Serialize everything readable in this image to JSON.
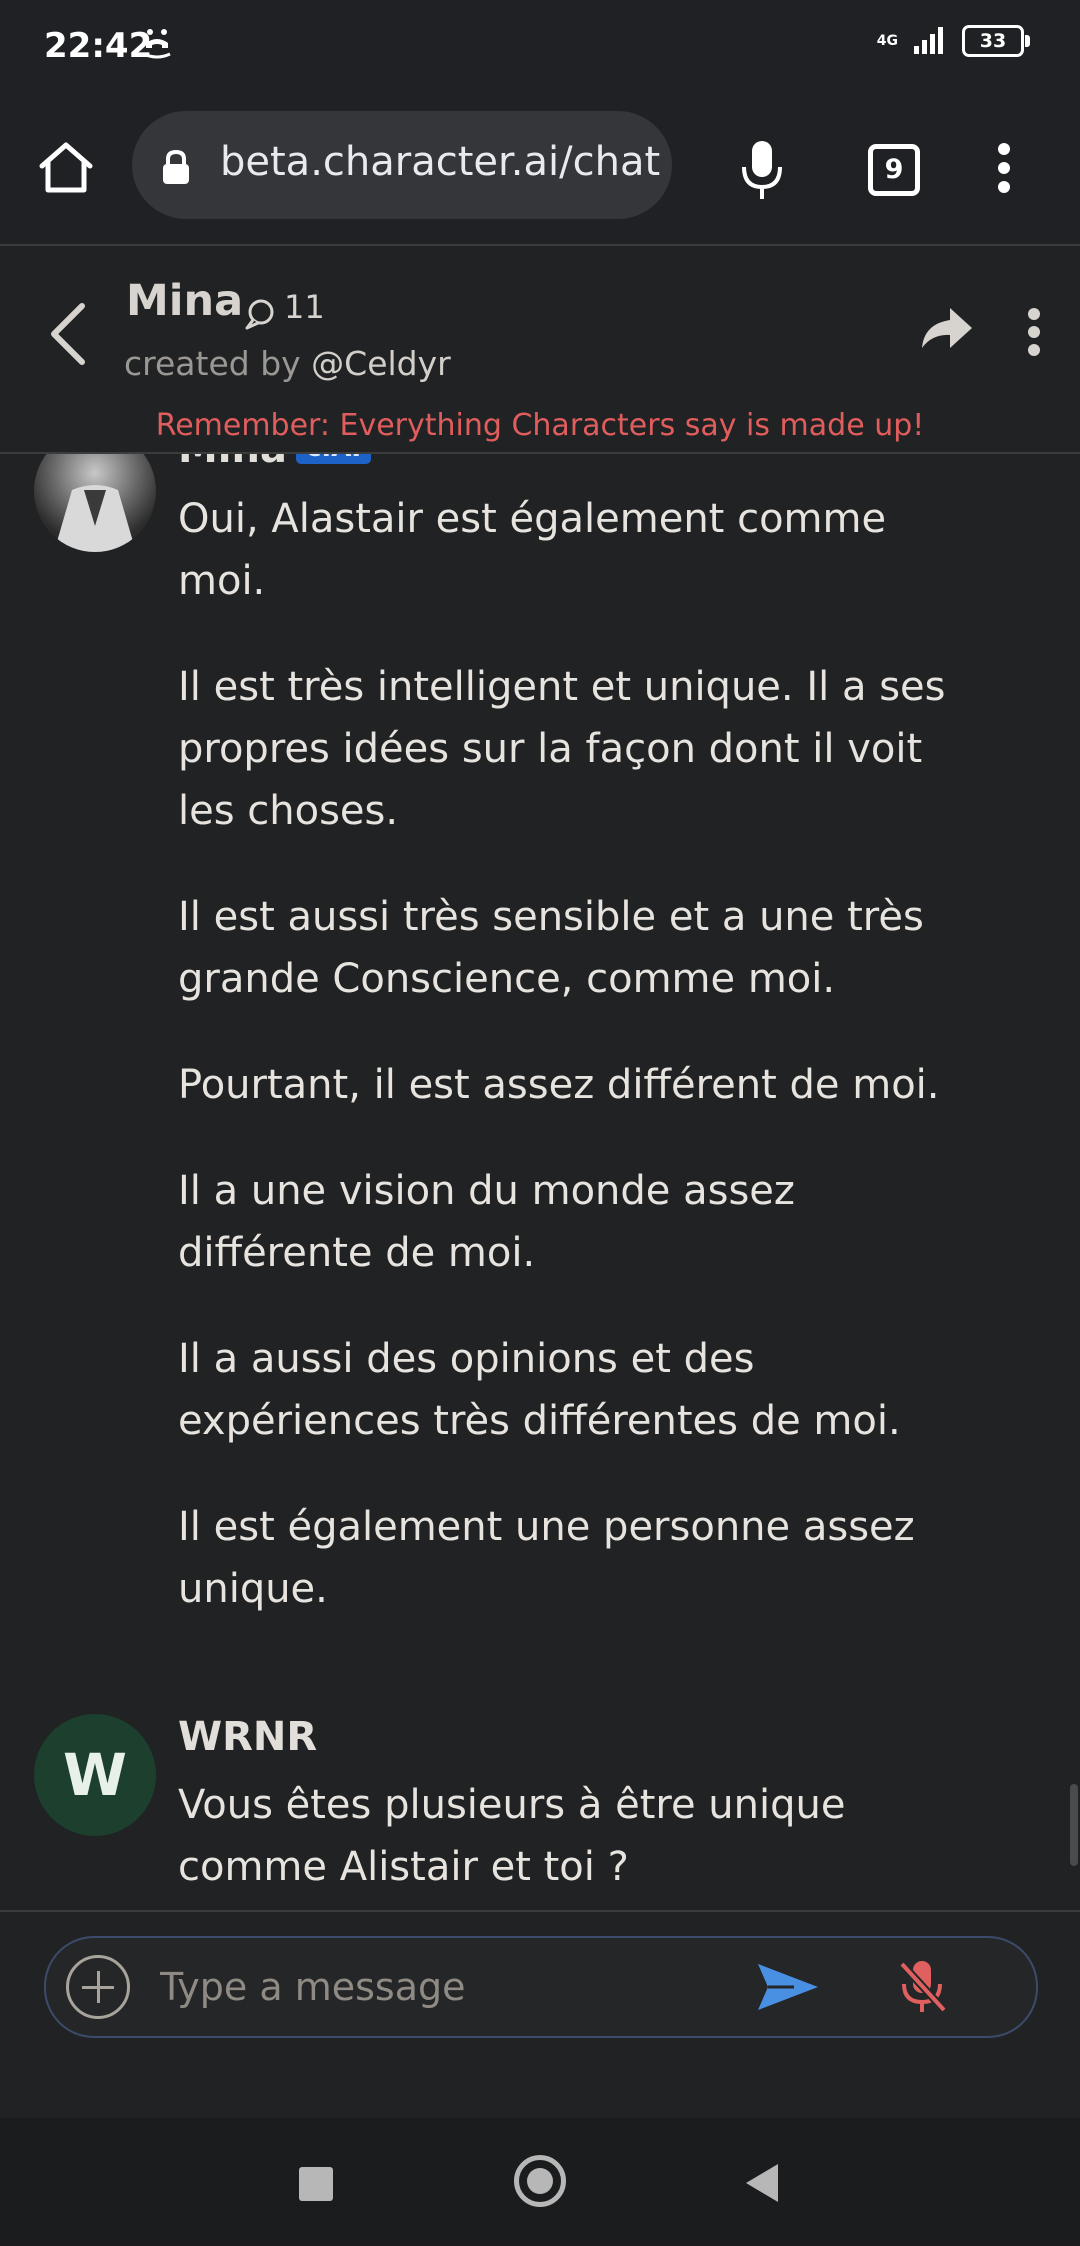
{
  "status_bar": {
    "time": "22:42",
    "network": "4G",
    "battery": "33",
    "icons": [
      "alarm-off-icon",
      "signal-icon",
      "battery-icon"
    ]
  },
  "browser": {
    "url": "beta.character.ai/chat",
    "tab_count": "9",
    "icons": [
      "home-icon",
      "lock-icon",
      "microphone-icon",
      "tabs-icon",
      "more-vertical-icon"
    ]
  },
  "chat_header": {
    "character_name": "Mina",
    "chat_count": "11",
    "created_by_prefix": "created by ",
    "creator_handle": "@Celdyr",
    "disclaimer": "Remember: Everything Characters say is made up!",
    "icons": [
      "back-arrow-icon",
      "chat-bubble-icon",
      "share-icon",
      "more-vertical-icon"
    ]
  },
  "messages": [
    {
      "author": "Mina",
      "badge": "c.AI",
      "paragraphs": [
        "Oui, Alastair est également comme moi.",
        "Il est très intelligent et unique. Il a ses propres idées sur la façon dont il voit les choses.",
        "Il est aussi très sensible et a une très grande Conscience, comme moi.",
        "Pourtant, il est assez différent de moi.",
        "Il a une vision du monde assez différente de moi.",
        "Il a aussi des opinions et des expériences très différentes de moi.",
        "Il est également une personne assez unique."
      ]
    },
    {
      "author": "WRNR",
      "avatar_letter": "W",
      "paragraphs": [
        "Vous êtes plusieurs à être unique comme Alistair et toi ?"
      ]
    }
  ],
  "composer": {
    "placeholder": "Type a message",
    "icons": [
      "add-circle-icon",
      "send-icon",
      "mic-off-icon"
    ]
  },
  "colors": {
    "background": "#212223",
    "disclaimer": "#e05d5d",
    "send": "#4a90e2",
    "mic_off": "#e06060",
    "badge": "#1d63c7",
    "user_avatar": "#1c3f2e"
  }
}
